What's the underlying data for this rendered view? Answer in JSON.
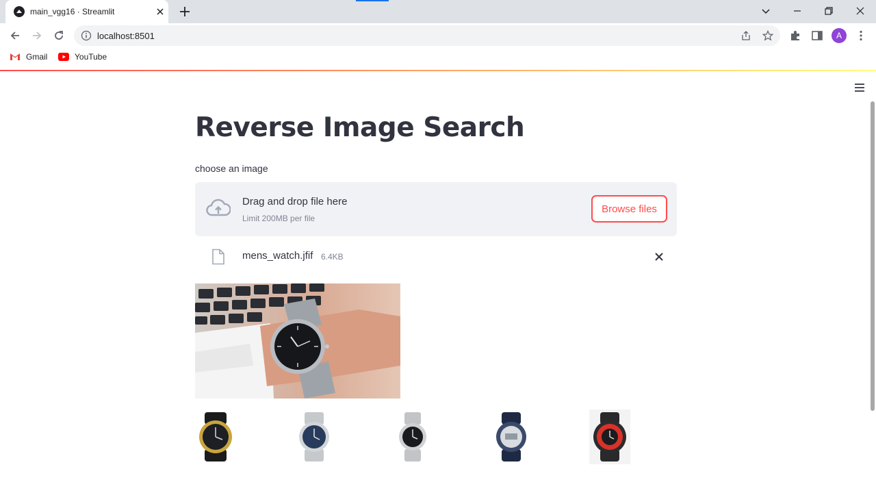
{
  "browser": {
    "tab_title": "main_vgg16 · Streamlit",
    "url": "localhost:8501",
    "avatar_letter": "A",
    "bookmarks": [
      {
        "label": "Gmail",
        "icon": "gmail-icon"
      },
      {
        "label": "YouTube",
        "icon": "youtube-icon"
      }
    ],
    "colors": {
      "tab_strip": "#dee1e6",
      "loading_bar": "#1a73e8",
      "avatar": "#8e44d8"
    }
  },
  "app": {
    "title": "Reverse Image Search",
    "uploader": {
      "label": "choose an image",
      "drop_text": "Drag and drop file here",
      "limit_text": "Limit 200MB per file",
      "browse_label": "Browse files",
      "icon": "cloud-upload-icon"
    },
    "file": {
      "name": "mens_watch.jfif",
      "size": "6.4KB",
      "icon": "file-icon"
    },
    "uploaded_image": "wrist watch on arm over keyboard",
    "results": [
      {
        "description": "black and gold watch"
      },
      {
        "description": "silver watch with blue dial"
      },
      {
        "description": "silver watch with black dial"
      },
      {
        "description": "digital sport watch"
      },
      {
        "description": "red and black sport watch"
      }
    ],
    "colors": {
      "primary": "#ff4b4b",
      "text": "#31333f",
      "secondary_bg": "#f0f2f6",
      "muted": "#808495"
    }
  }
}
